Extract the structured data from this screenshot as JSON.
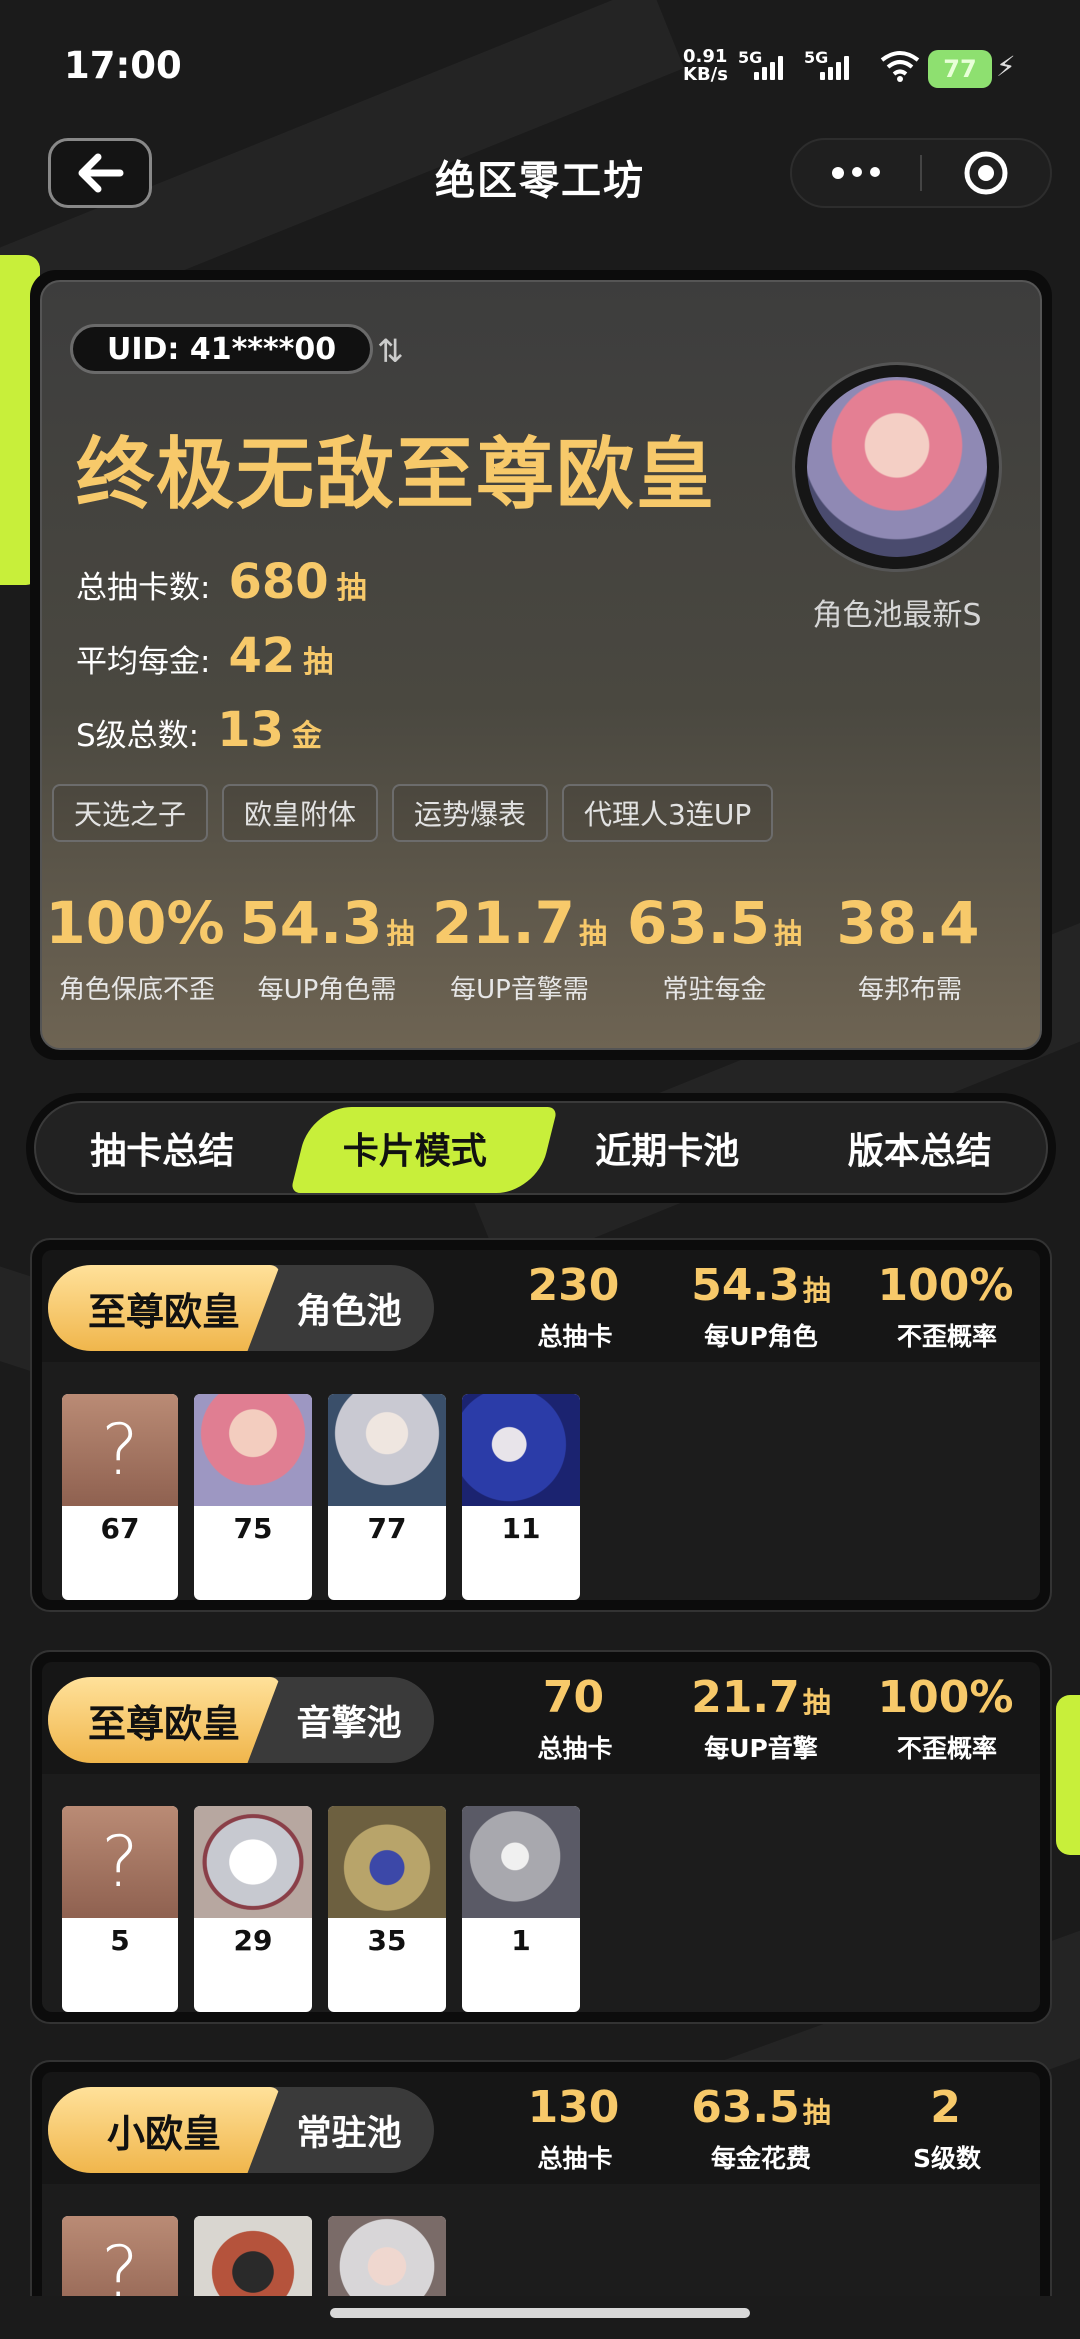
{
  "status_bar": {
    "time": "17:00",
    "net_speed_value": "0.91",
    "net_speed_unit": "KB/s",
    "sim1": "5G",
    "sim2": "5G",
    "battery": "77"
  },
  "nav": {
    "title": "绝区零工坊"
  },
  "profile": {
    "uid": "UID: 41****00",
    "rank_title": "终极无敌至尊欧皇",
    "stats": [
      {
        "label": "总抽卡数:",
        "value": "680",
        "unit": "抽"
      },
      {
        "label": "平均每金:",
        "value": "42",
        "unit": "抽"
      },
      {
        "label": "S级总数:",
        "value": "13",
        "unit": "金"
      }
    ],
    "avatar_caption": "角色池最新S",
    "tags": [
      "天选之子",
      "欧皇附体",
      "运势爆表",
      "代理人3连UP"
    ],
    "summary": [
      {
        "value": "100%",
        "unit": "",
        "label": "角色保底不歪"
      },
      {
        "value": "54.3",
        "unit": "抽",
        "label": "每UP角色需"
      },
      {
        "value": "21.7",
        "unit": "抽",
        "label": "每UP音擎需"
      },
      {
        "value": "63.5",
        "unit": "抽",
        "label": "常驻每金"
      },
      {
        "value": "38.4",
        "unit": "",
        "label": "每邦布需"
      }
    ]
  },
  "tabs": [
    "抽卡总结",
    "卡片模式",
    "近期卡池",
    "版本总结"
  ],
  "active_tab": "卡片模式",
  "pools": [
    {
      "grade": "至尊欧皇",
      "pool": "角色池",
      "stats": [
        {
          "value": "230",
          "unit": "",
          "label": "总抽卡"
        },
        {
          "value": "54.3",
          "unit": "抽",
          "label": "每UP角色"
        },
        {
          "value": "100%",
          "unit": "",
          "label": "不歪概率"
        }
      ],
      "items": [
        {
          "icon": "unknown-card",
          "glyph": "?",
          "count": "67"
        },
        {
          "icon": "pink-hair-agent",
          "count": "75"
        },
        {
          "icon": "silver-hair-agent",
          "count": "77"
        },
        {
          "icon": "blue-hair-agent",
          "count": "11"
        }
      ]
    },
    {
      "grade": "至尊欧皇",
      "pool": "音擎池",
      "stats": [
        {
          "value": "70",
          "unit": "",
          "label": "总抽卡"
        },
        {
          "value": "21.7",
          "unit": "抽",
          "label": "每UP音擎"
        },
        {
          "value": "100%",
          "unit": "",
          "label": "不歪概率"
        }
      ],
      "items": [
        {
          "icon": "unknown-card",
          "glyph": "?",
          "count": "5"
        },
        {
          "icon": "white-blade-engine",
          "count": "29"
        },
        {
          "icon": "golden-orb-engine",
          "count": "35"
        },
        {
          "icon": "silver-sphere-engine",
          "count": "1"
        }
      ]
    },
    {
      "grade": "小欧皇",
      "pool": "常驻池",
      "stats": [
        {
          "value": "130",
          "unit": "",
          "label": "总抽卡"
        },
        {
          "value": "63.5",
          "unit": "抽",
          "label": "每金花费"
        },
        {
          "value": "2",
          "unit": "",
          "label": "S级数"
        }
      ],
      "items": [
        {
          "icon": "unknown-card",
          "glyph": "?",
          "count": ""
        },
        {
          "icon": "red-armor-agent",
          "count": ""
        },
        {
          "icon": "white-hair-agent",
          "count": ""
        }
      ]
    }
  ],
  "colors": {
    "accent_lime": "#c8ef3a",
    "gold": "#f7c96a",
    "background": "#1b1b1b"
  }
}
